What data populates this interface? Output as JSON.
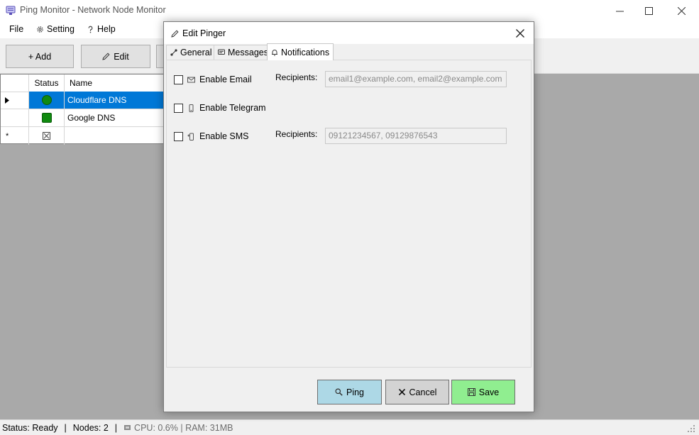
{
  "window": {
    "title": "Ping Monitor - Network Node Monitor",
    "app_icon": "monitor-icon",
    "controls": [
      "minimize-icon",
      "maximize-icon",
      "close-icon"
    ]
  },
  "menu": {
    "file": "File",
    "setting": "Setting",
    "setting_icon": "gear-icon",
    "help": "Help",
    "help_icon": "question-icon"
  },
  "toolbar": {
    "add_label": "+ Add",
    "edit_label": "Edit",
    "edit_icon": "pencil-icon"
  },
  "grid": {
    "columns": [
      "Status",
      "Name"
    ],
    "rows": [
      {
        "status": "online",
        "name": "Cloudflare DNS",
        "selected": true
      },
      {
        "status": "online",
        "name": "Google DNS",
        "selected": false
      }
    ],
    "new_row_marker": "*",
    "status_color": "#0f8a0f",
    "selection_color": "#0078d7"
  },
  "statusbar": {
    "status": "Status: Ready",
    "nodes": "Nodes: 2",
    "resources": "CPU: 0.6% | RAM: 31MB",
    "sep": "|"
  },
  "dialog": {
    "title": "Edit Pinger",
    "title_icon": "pencil-icon",
    "tabs": [
      {
        "label": "General",
        "icon": "network-icon",
        "active": false
      },
      {
        "label": "Messages",
        "icon": "message-icon",
        "active": false
      },
      {
        "label": "Notifications",
        "icon": "bell-icon",
        "active": true
      }
    ],
    "notifications": {
      "email": {
        "label": "Enable Email",
        "icon": "email-icon",
        "checked": false,
        "recipients_label": "Recipients:",
        "recipients_placeholder": "email1@example.com, email2@example.com"
      },
      "telegram": {
        "label": "Enable Telegram",
        "icon": "phone-icon",
        "checked": false
      },
      "sms": {
        "label": "Enable SMS",
        "icon": "sms-icon",
        "checked": false,
        "recipients_label": "Recipients:",
        "recipients_placeholder": "09121234567, 09129876543"
      }
    },
    "buttons": {
      "ping": {
        "label": "Ping",
        "icon": "search-icon",
        "color": "#add8e6"
      },
      "cancel": {
        "label": "Cancel",
        "icon": "x-icon",
        "color": "#d3d3d3"
      },
      "save": {
        "label": "Save",
        "icon": "floppy-icon",
        "color": "#90ee90"
      }
    }
  }
}
